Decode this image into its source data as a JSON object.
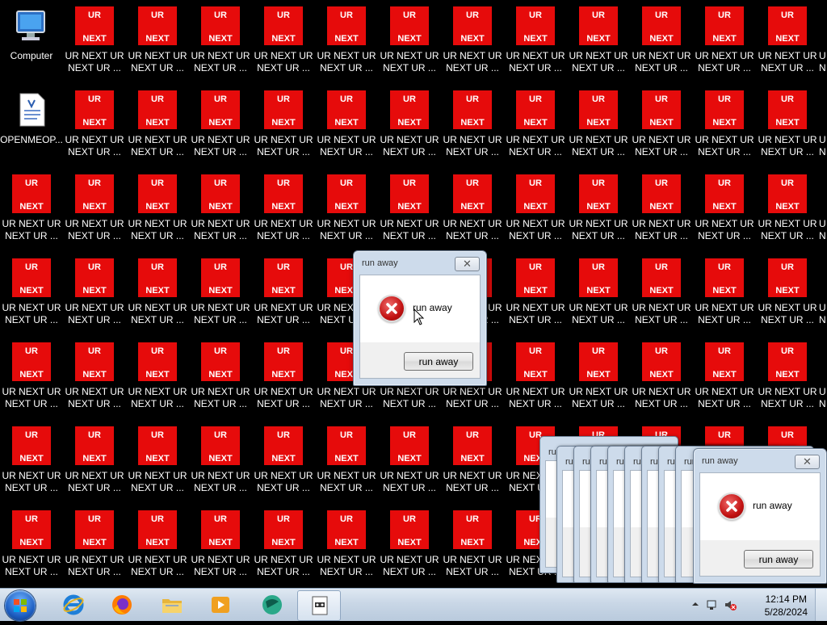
{
  "desktop": {
    "computer_label": "Computer",
    "document_label": "OPENMEOP...",
    "ur_icon": {
      "line1": "UR NEXT UR",
      "line2": "NEXT UR ...",
      "img_top": "UR",
      "img_bottom": "NEXT"
    },
    "partial_line1": "U",
    "partial_line2": "N"
  },
  "dialog_main": {
    "title": "run away",
    "message": "run away",
    "button": "run away",
    "close_glyph": "✕"
  },
  "dialog_front": {
    "title": "run away",
    "message": "run away",
    "button": "run away",
    "close_glyph": "✕"
  },
  "dialog_stack_title": "run away",
  "taskbar": {
    "time": "12:14 PM",
    "date": "5/28/2024"
  },
  "colors": {
    "ur_red": "#e60b0b",
    "desktop_bg": "#000000"
  }
}
